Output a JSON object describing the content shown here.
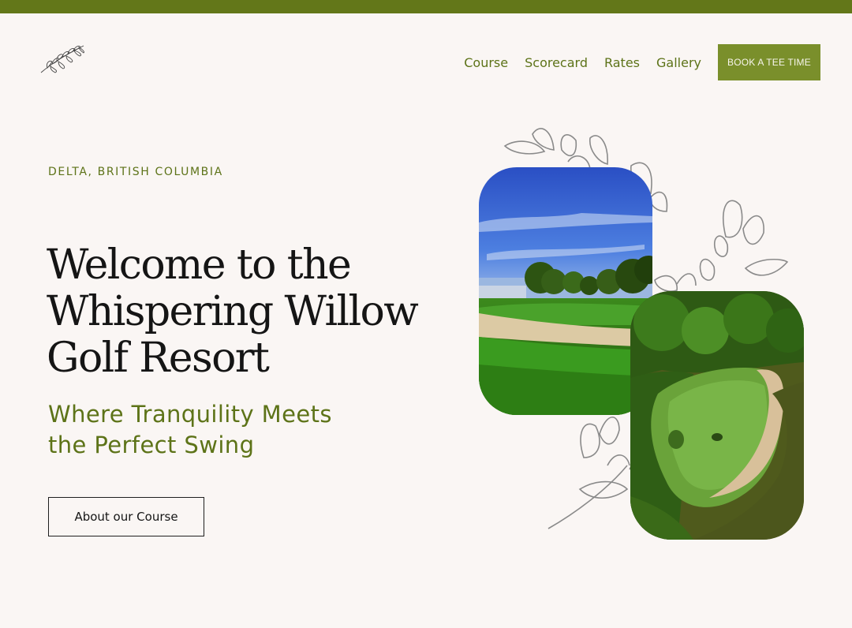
{
  "nav": {
    "links": [
      {
        "label": "Course"
      },
      {
        "label": "Scorecard"
      },
      {
        "label": "Rates"
      },
      {
        "label": "Gallery"
      }
    ],
    "book_label": "BOOK A TEE TIME"
  },
  "hero": {
    "location": "DELTA, BRITISH COLUMBIA",
    "headline_line1": "Welcome to the",
    "headline_line2": "Whispering Willow",
    "headline_line3": "Golf Resort",
    "tagline_line1": "Where Tranquility Meets",
    "tagline_line2": "the Perfect Swing",
    "about_label": "About our Course"
  },
  "icons": {
    "logo": "willow-branch-logo",
    "decoration": "willow-leaf-illustration"
  },
  "colors": {
    "accent": "#637719",
    "button": "#7a8f2b",
    "background": "#faf6f4",
    "text": "#151515"
  }
}
